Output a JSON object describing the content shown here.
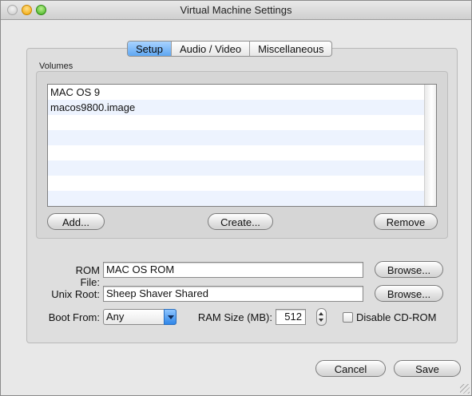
{
  "window": {
    "title": "Virtual Machine Settings"
  },
  "tabs": [
    {
      "label": "Setup",
      "active": true
    },
    {
      "label": "Audio / Video",
      "active": false
    },
    {
      "label": "Miscellaneous",
      "active": false
    }
  ],
  "volumes": {
    "label": "Volumes",
    "items": [
      "MAC OS 9",
      "macos9800.image",
      "",
      "",
      "",
      "",
      "",
      ""
    ],
    "add_label": "Add...",
    "create_label": "Create...",
    "remove_label": "Remove"
  },
  "rom": {
    "label": "ROM File:",
    "value": "MAC OS ROM",
    "browse_label": "Browse..."
  },
  "unix_root": {
    "label": "Unix Root:",
    "value": "Sheep Shaver Shared",
    "browse_label": "Browse..."
  },
  "boot": {
    "label": "Boot From:",
    "value": "Any"
  },
  "ram": {
    "label": "RAM Size (MB):",
    "value": "512"
  },
  "cdrom": {
    "label": "Disable CD-ROM",
    "checked": false
  },
  "footer": {
    "cancel_label": "Cancel",
    "save_label": "Save"
  },
  "colors": {
    "tab_active": "#5fa7f2",
    "row_alt": "#edf3fe",
    "popup_arrow": "#2f86e8"
  }
}
